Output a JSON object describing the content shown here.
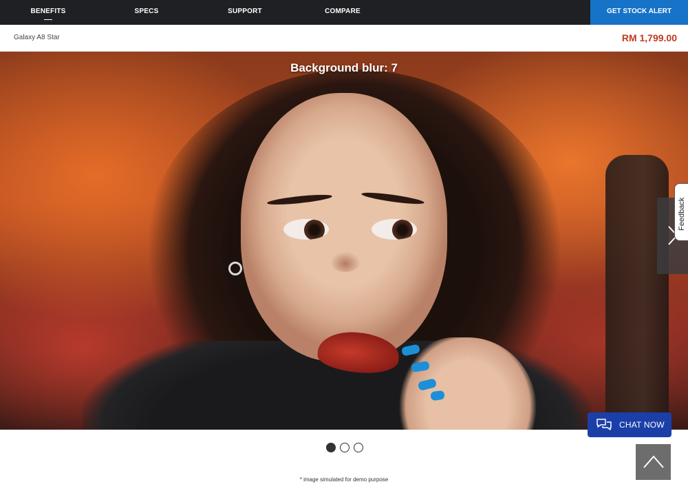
{
  "nav": {
    "items": [
      {
        "label": "BENEFITS",
        "active": true
      },
      {
        "label": "SPECS",
        "active": false
      },
      {
        "label": "SUPPORT",
        "active": false
      },
      {
        "label": "COMPARE",
        "active": false
      }
    ],
    "cta_label": "GET STOCK ALERT"
  },
  "product": {
    "name": "Galaxy A8 Star",
    "price": "RM 1,799.00"
  },
  "hero": {
    "caption": "Background blur: 7"
  },
  "feedback": {
    "label": "Feedback"
  },
  "chat": {
    "label": "CHAT NOW"
  },
  "carousel": {
    "slide_count": 3,
    "active_index": 0
  },
  "disclaimer": "* image simulated for demo purpose",
  "colors": {
    "nav_bg": "#1f2023",
    "cta_blue": "#1673c8",
    "price_red": "#c0391b",
    "chat_blue": "#1b3fa8"
  },
  "icons": {
    "next": "chevron-right-icon",
    "chat": "chat-bubbles-icon",
    "to_top": "chevron-up-icon"
  }
}
